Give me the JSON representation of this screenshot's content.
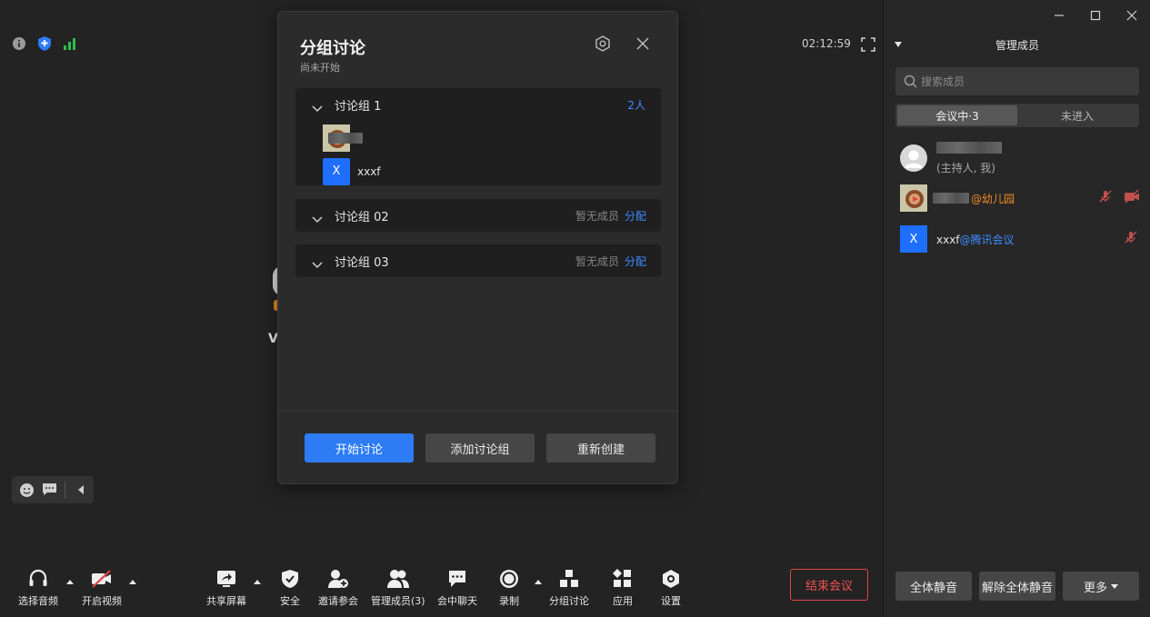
{
  "window": {
    "minimize_icon": "minimize-icon",
    "maximize_icon": "maximize-icon",
    "close_icon": "close-icon"
  },
  "status": {
    "timer": "02:12:59"
  },
  "tile": {
    "name_initial": "V"
  },
  "toolbar": {
    "audio": "选择音频",
    "video": "开启视频",
    "share": "共享屏幕",
    "security": "安全",
    "invite": "邀请参会",
    "members": "管理成员(3)",
    "chat": "会中聊天",
    "record": "录制",
    "breakout": "分组讨论",
    "apps": "应用",
    "settings": "设置",
    "end": "结束会议"
  },
  "dialog": {
    "title": "分组讨论",
    "subtitle": "尚未开始",
    "groups": [
      {
        "name": "讨论组 1",
        "count": "2人",
        "members": [
          {
            "name": ""
          },
          {
            "initial": "X",
            "name": "xxxf"
          }
        ]
      },
      {
        "name": "讨论组 02",
        "empty": "暂无成员",
        "assign": "分配"
      },
      {
        "name": "讨论组 03",
        "empty": "暂无成员",
        "assign": "分配"
      }
    ],
    "buttons": {
      "start": "开始讨论",
      "add": "添加讨论组",
      "recreate": "重新创建"
    }
  },
  "panel": {
    "title": "管理成员",
    "search_placeholder": "搜索成员",
    "tabs": {
      "in_meeting": "会议中·3",
      "not_joined": "未进入"
    },
    "members": [
      {
        "name": "",
        "role": "(主持人, 我)"
      },
      {
        "name": "",
        "tag": "@幼儿园"
      },
      {
        "initial": "X",
        "name": "xxxf",
        "tag": "@腾讯会议"
      }
    ],
    "buttons": {
      "mute_all": "全体静音",
      "unmute_all": "解除全体静音",
      "more": "更多"
    }
  },
  "colors": {
    "accent": "#2d7cf6",
    "danger": "#e04545",
    "tag_orange": "#f08a24",
    "signal_green": "#2dbb4e"
  }
}
